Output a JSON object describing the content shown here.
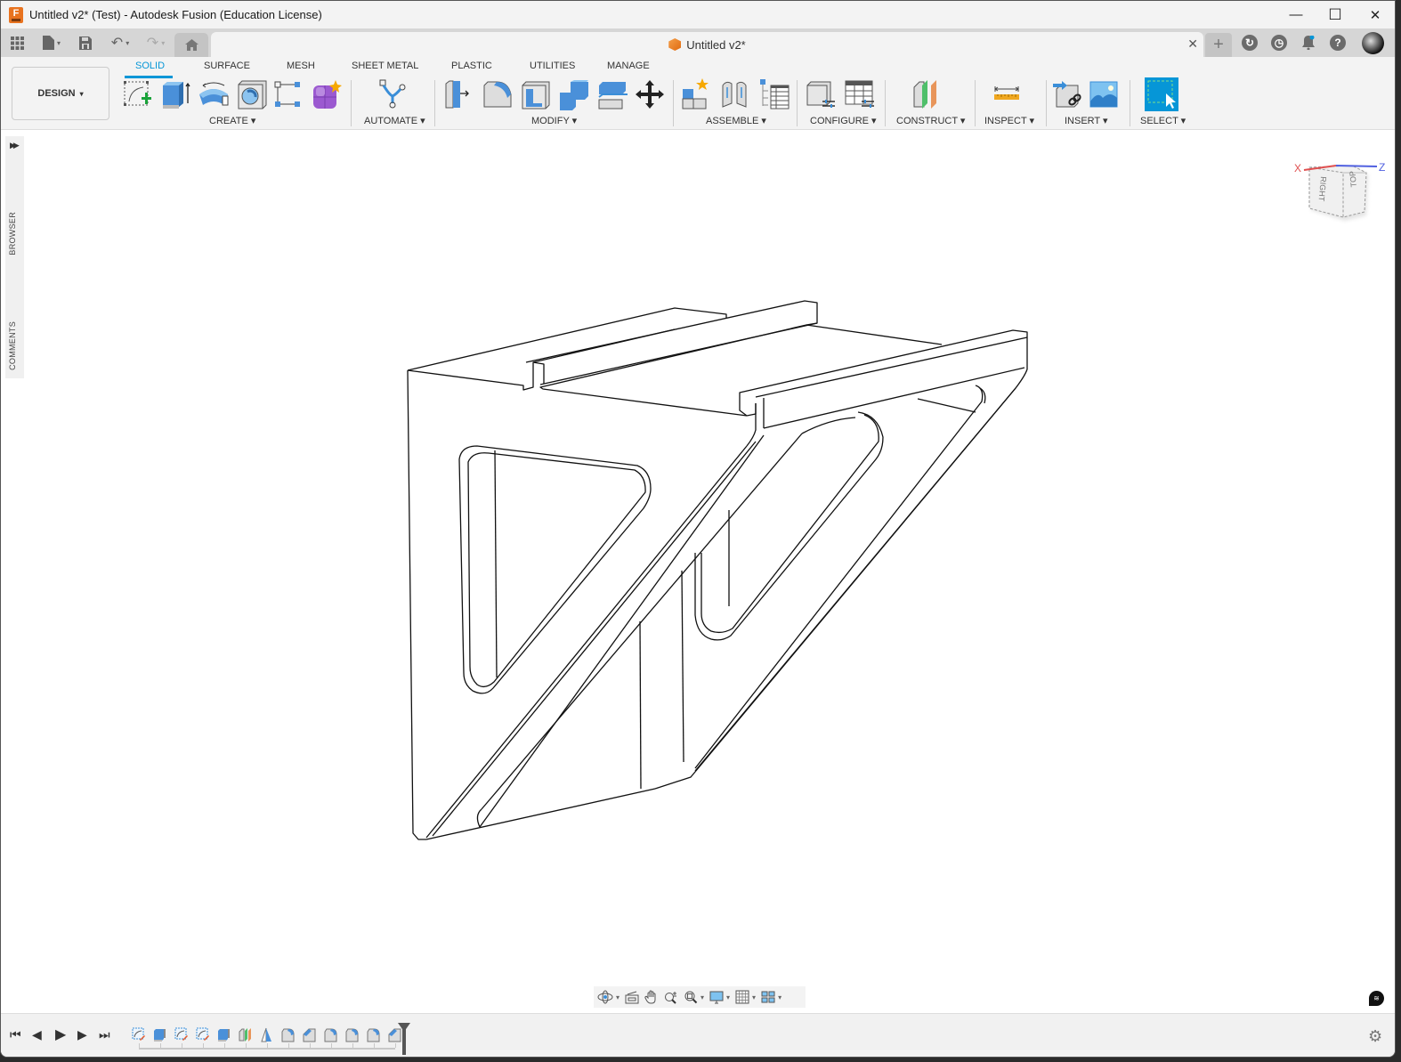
{
  "window": {
    "title": "Untitled v2* (Test) - Autodesk Fusion (Education License)",
    "app_logo_letter": "F",
    "minimize": "—",
    "maximize": "☐",
    "close": "✕"
  },
  "qat": {
    "grid_icon": "▦",
    "file_icon": "🗎",
    "save_icon": "💾",
    "undo_icon": "↶",
    "redo_icon": "↷",
    "caret": "▾"
  },
  "document_tab": {
    "label": "Untitled v2*",
    "close": "✕",
    "new_tab": "+"
  },
  "right_icons": {
    "extensions": "↻",
    "job_status": "◷",
    "notifications": "🔔",
    "help": "?"
  },
  "ribbon": {
    "workspace": "DESIGN",
    "workspace_caret": "▾",
    "tabs": [
      "SOLID",
      "SURFACE",
      "MESH",
      "SHEET METAL",
      "PLASTIC",
      "UTILITIES",
      "MANAGE"
    ],
    "active_tab": "SOLID",
    "groups": [
      {
        "label": "CREATE ▾",
        "tools": [
          "create-sketch",
          "extrude",
          "revolve",
          "hole",
          "pattern",
          "create-form"
        ]
      },
      {
        "label": "AUTOMATE ▾",
        "tools": [
          "automate"
        ]
      },
      {
        "label": "MODIFY ▾",
        "tools": [
          "press-pull",
          "fillet",
          "shell",
          "combine",
          "offset-face",
          "move-copy"
        ]
      },
      {
        "label": "ASSEMBLE ▾",
        "tools": [
          "new-component",
          "joint",
          "bill-of-materials"
        ]
      },
      {
        "label": "CONFIGURE ▾",
        "tools": [
          "configure-model",
          "configuration-table"
        ]
      },
      {
        "label": "CONSTRUCT ▾",
        "tools": [
          "offset-plane"
        ]
      },
      {
        "label": "INSPECT ▾",
        "tools": [
          "measure"
        ]
      },
      {
        "label": "INSERT ▾",
        "tools": [
          "insert-derive",
          "insert-canvas"
        ]
      },
      {
        "label": "SELECT ▾",
        "tools": [
          "select"
        ]
      }
    ]
  },
  "left_panel": {
    "expand": "▶▶",
    "browser": "BROWSER",
    "comments": "COMMENTS"
  },
  "viewcube": {
    "x_label": "X",
    "z_label": "Z",
    "face_right": "RIGHT",
    "face_top": "TOP"
  },
  "navbar": {
    "items": [
      "orbit",
      "look-at",
      "pan",
      "zoom",
      "fit",
      "display-settings",
      "grid-snaps",
      "viewports"
    ]
  },
  "timeline": {
    "controls": [
      "⏮",
      "◀",
      "▶",
      "▶",
      "⏭"
    ],
    "features": [
      "sketch",
      "extrude",
      "sketch",
      "sketch",
      "extrude",
      "offset-plane",
      "draft",
      "fillet",
      "chamfer",
      "fillet",
      "fillet",
      "fillet",
      "chamfer"
    ]
  },
  "colors": {
    "accent": "#0696d7",
    "select_bg": "#0696d7",
    "x_axis": "#e05050",
    "z_axis": "#5060e0"
  }
}
